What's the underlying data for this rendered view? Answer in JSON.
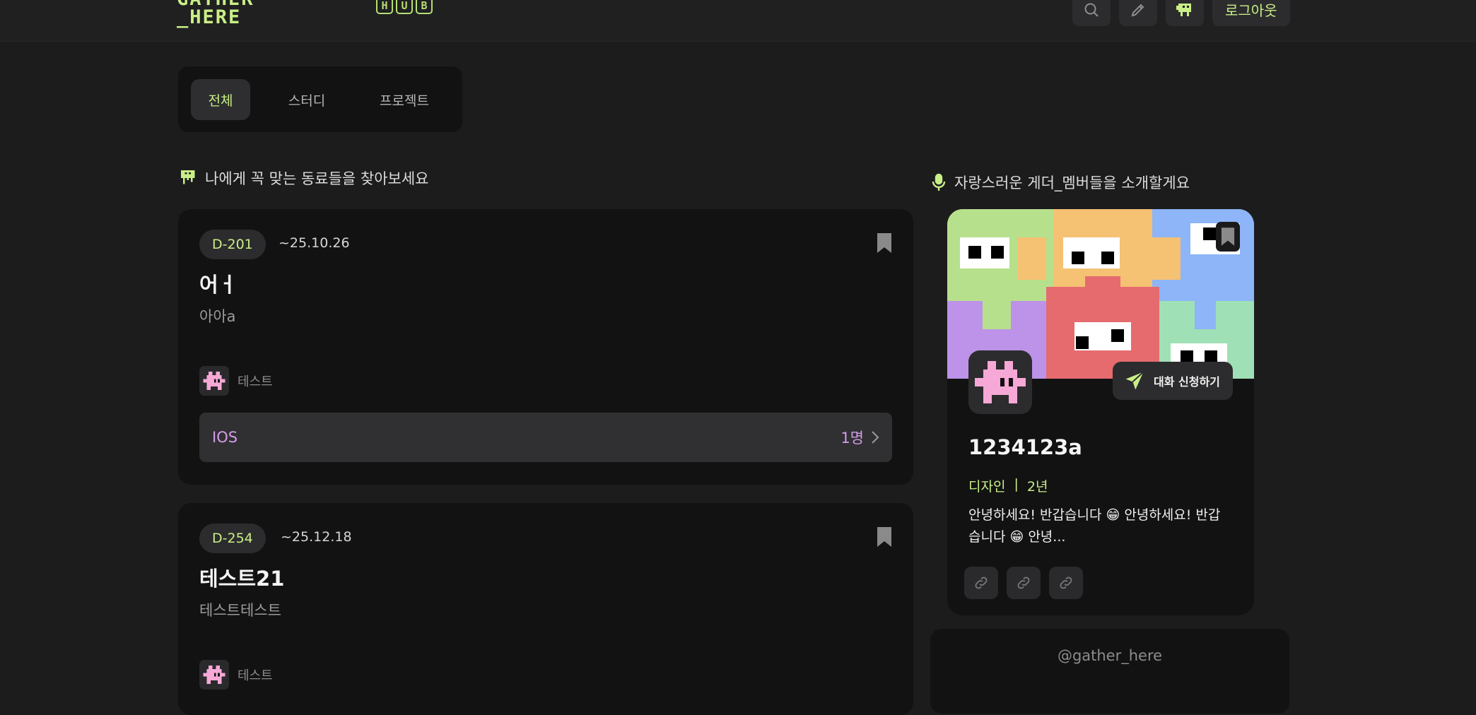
{
  "header": {
    "logo_text": "GATHER\n_HERE",
    "hub_letters": [
      "H",
      "U",
      "B"
    ],
    "logout_label": "로그아웃"
  },
  "tabs": [
    {
      "label": "전체",
      "active": true
    },
    {
      "label": "스터디",
      "active": false
    },
    {
      "label": "프로젝트",
      "active": false
    }
  ],
  "left_section_title": "나에게 꼭 맞는 동료들을 찾아보세요",
  "right_section_title": "자랑스러운 게더_멤버들을 소개할게요",
  "posts": [
    {
      "dday": "D-201",
      "date": "~25.10.26",
      "title": "어ㅓ",
      "desc": "아아a",
      "author": "테스트",
      "role": "IOS",
      "count": "1명"
    },
    {
      "dday": "D-254",
      "date": "~25.12.18",
      "title": "테스트21",
      "desc": "테스트테스트",
      "author": "테스트"
    }
  ],
  "member": {
    "chat_label": "대화 신청하기",
    "name": "1234123a",
    "job": "디자인",
    "separator": "|",
    "years": "2년",
    "intro": "안녕하세요! 반갑습니다 😁 안녕하세요! 반갑습니다 😁 안녕..."
  },
  "footer": {
    "handle": "@gather_here"
  },
  "colors": {
    "accent_green": "#c9ef86",
    "role_purple": "#d49ce8",
    "avatar_pink": "#f6a9d6"
  }
}
